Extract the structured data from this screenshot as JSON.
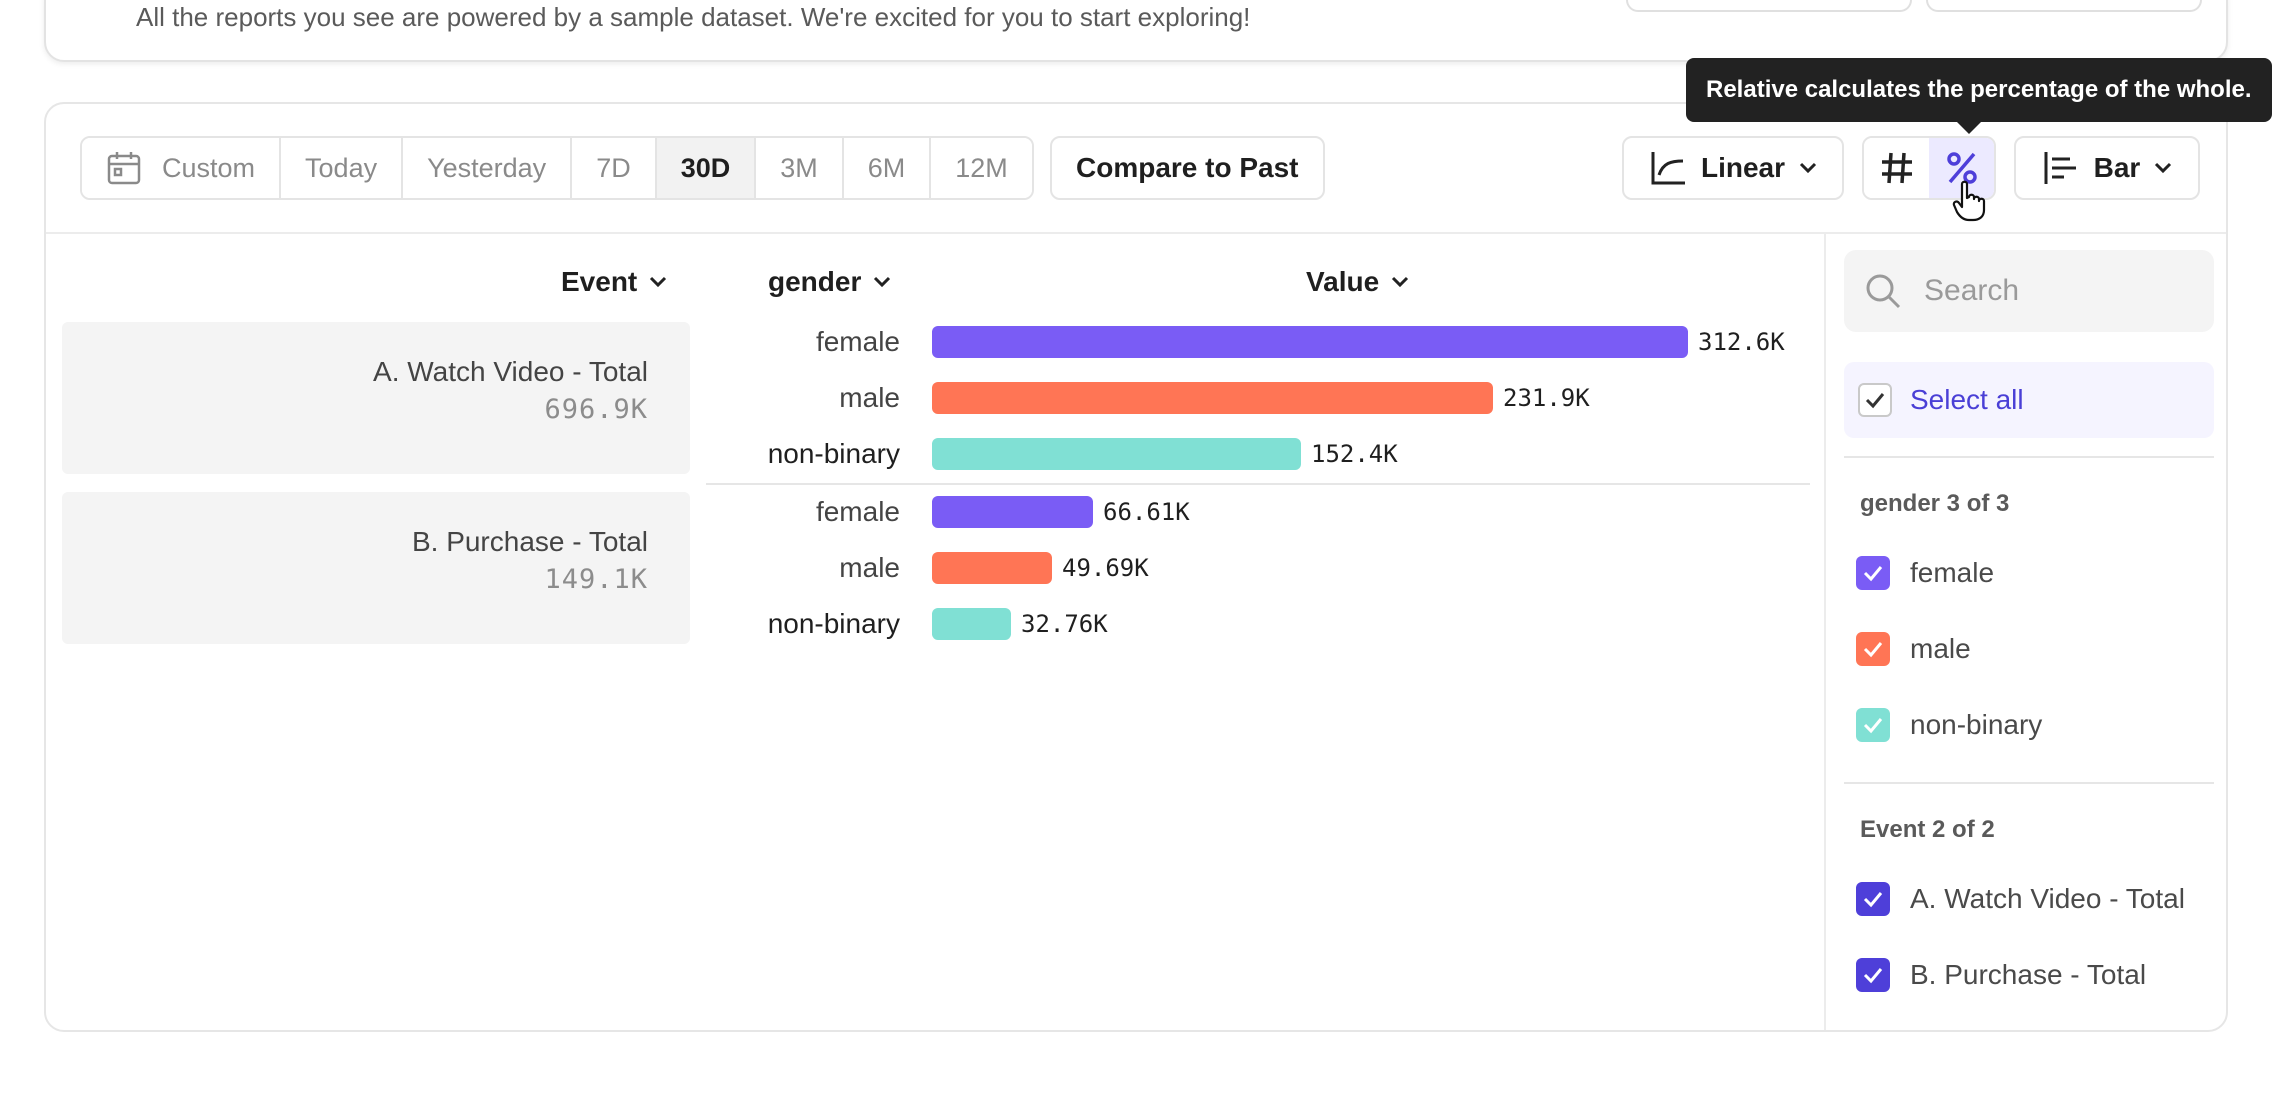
{
  "banner": {
    "text": "All the reports you see are powered by a sample dataset. We're excited for you to start exploring!"
  },
  "toolbar": {
    "date_ranges": [
      "Custom",
      "Today",
      "Yesterday",
      "7D",
      "30D",
      "3M",
      "6M",
      "12M"
    ],
    "active_range": "30D",
    "compare_label": "Compare to Past",
    "scale_label": "Linear",
    "chart_type_label": "Bar",
    "tooltip": "Relative calculates the percentage of the whole.",
    "active_toggle": "percent"
  },
  "table": {
    "headers": {
      "event": "Event",
      "gender": "gender",
      "value": "Value"
    },
    "events": [
      {
        "name": "A. Watch Video - Total",
        "total": "696.9K",
        "rows": [
          {
            "gender": "female",
            "value": 312.6,
            "label": "312.6K",
            "color": "#7a5cf5"
          },
          {
            "gender": "male",
            "value": 231.9,
            "label": "231.9K",
            "color": "#ff7555"
          },
          {
            "gender": "non-binary",
            "value": 152.4,
            "label": "152.4K",
            "color": "#80e0d4"
          }
        ]
      },
      {
        "name": "B. Purchase - Total",
        "total": "149.1K",
        "rows": [
          {
            "gender": "female",
            "value": 66.61,
            "label": "66.61K",
            "color": "#7a5cf5"
          },
          {
            "gender": "male",
            "value": 49.69,
            "label": "49.69K",
            "color": "#ff7555"
          },
          {
            "gender": "non-binary",
            "value": 32.76,
            "label": "32.76K",
            "color": "#80e0d4"
          }
        ]
      }
    ]
  },
  "panel": {
    "search_placeholder": "Search",
    "select_all": "Select all",
    "gender_group": {
      "title": "gender 3 of 3",
      "items": [
        {
          "label": "female",
          "color": "#7a5cf5"
        },
        {
          "label": "male",
          "color": "#ff7555"
        },
        {
          "label": "non-binary",
          "color": "#80e0d4"
        }
      ]
    },
    "event_group": {
      "title": "Event 2 of 2",
      "items": [
        {
          "label": "A. Watch Video - Total",
          "color": "#4e3fd9"
        },
        {
          "label": "B. Purchase - Total",
          "color": "#4e3fd9"
        }
      ]
    }
  }
}
